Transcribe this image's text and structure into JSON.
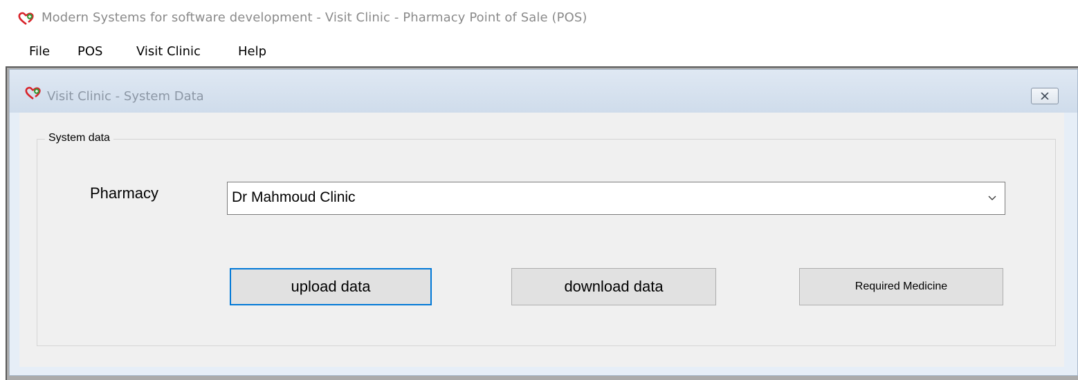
{
  "window": {
    "title": "Modern Systems for software development - Visit Clinic - Pharmacy Point of Sale (POS)",
    "logo_icon": "heart-logo-icon"
  },
  "menu": {
    "items": [
      {
        "label": "File"
      },
      {
        "label": "POS"
      },
      {
        "label": "Visit Clinic"
      },
      {
        "label": "Help"
      }
    ]
  },
  "child_window": {
    "title": "Visit Clinic - System Data",
    "close_icon": "close-icon"
  },
  "system_data": {
    "group_label": "System data",
    "pharmacy_label": "Pharmacy",
    "pharmacy_selected": "Dr Mahmoud Clinic",
    "buttons": {
      "upload": "upload data",
      "download": "download data",
      "required": "Required Medicine"
    }
  },
  "colors": {
    "focus_border": "#0078d7",
    "child_title_bg": "#dfe8f3",
    "logo_red": "#d8232a",
    "logo_green": "#3a9a3a"
  }
}
